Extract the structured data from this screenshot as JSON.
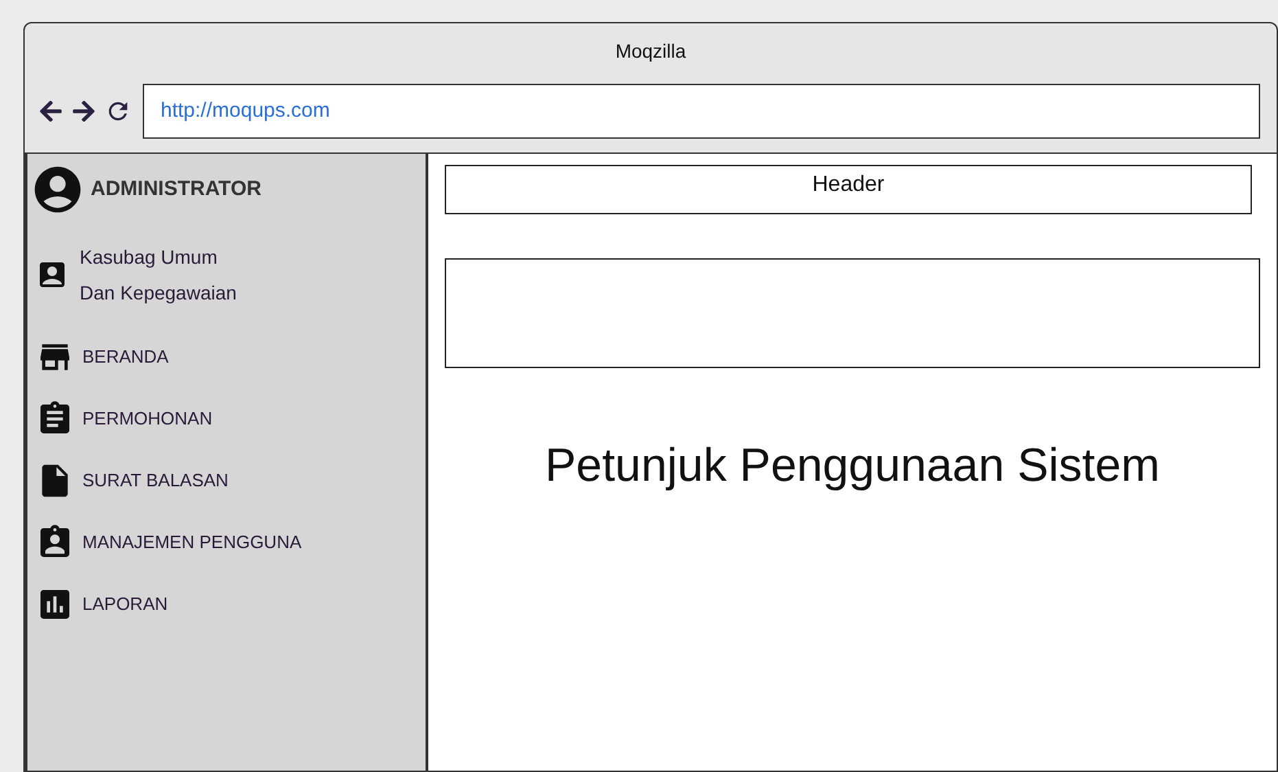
{
  "window": {
    "title": "Moqzilla"
  },
  "address_bar": {
    "url": "http://moqups.com"
  },
  "sidebar": {
    "user": "ADMINISTRATOR",
    "role": [
      "Kasubag Umum",
      "Dan Kepegawaian"
    ],
    "items": [
      {
        "label": "BERANDA"
      },
      {
        "label": "PERMOHONAN"
      },
      {
        "label": "SURAT BALASAN"
      },
      {
        "label": "MANAJEMEN PENGGUNA"
      },
      {
        "label": "LAPORAN"
      }
    ]
  },
  "main": {
    "header": "Header",
    "heading": "Petunjuk Penggunaan Sistem"
  }
}
